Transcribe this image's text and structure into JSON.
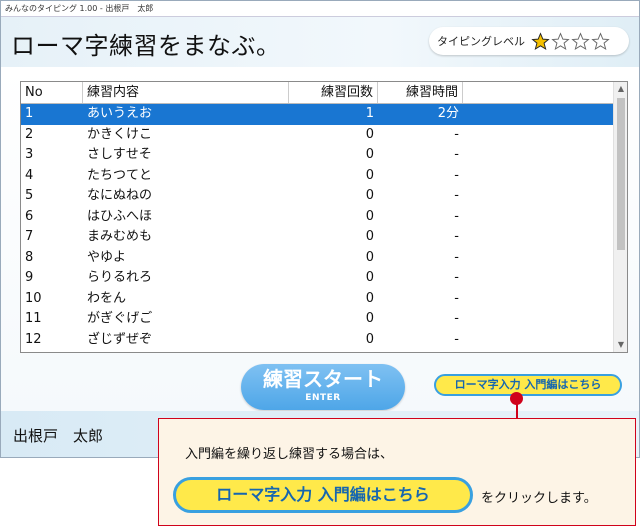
{
  "window": {
    "title": "みんなのタイピング 1.00 - 出根戸　太郎"
  },
  "header": {
    "page_title": "ローマ字練習をまなぶ。",
    "level_label": "タイピングレベル",
    "level_stars": {
      "filled": 1,
      "total": 4
    },
    "colors": {
      "star_filled": "#f5c000",
      "star_empty": "#ffffff"
    }
  },
  "grid": {
    "columns": [
      "No",
      "練習内容",
      "練習回数",
      "練習時間"
    ],
    "rows": [
      {
        "no": "1",
        "content": "あいうえお",
        "count": "1",
        "time": "2分",
        "selected": true
      },
      {
        "no": "2",
        "content": "かきくけこ",
        "count": "0",
        "time": "-"
      },
      {
        "no": "3",
        "content": "さしすせそ",
        "count": "0",
        "time": "-"
      },
      {
        "no": "4",
        "content": "たちつてと",
        "count": "0",
        "time": "-"
      },
      {
        "no": "5",
        "content": "なにぬねの",
        "count": "0",
        "time": "-"
      },
      {
        "no": "6",
        "content": "はひふへほ",
        "count": "0",
        "time": "-"
      },
      {
        "no": "7",
        "content": "まみむめも",
        "count": "0",
        "time": "-"
      },
      {
        "no": "8",
        "content": "やゆよ",
        "count": "0",
        "time": "-"
      },
      {
        "no": "9",
        "content": "らりるれろ",
        "count": "0",
        "time": "-"
      },
      {
        "no": "10",
        "content": "わをん",
        "count": "0",
        "time": "-"
      },
      {
        "no": "11",
        "content": "がぎぐげご",
        "count": "0",
        "time": "-"
      },
      {
        "no": "12",
        "content": "ざじずぜぞ",
        "count": "0",
        "time": "-"
      }
    ],
    "selection_color": "#1976d2"
  },
  "buttons": {
    "start_label": "練習スタート",
    "start_sub": "ENTER",
    "intro_link": "ローマ字入力 入門編はこちら"
  },
  "footer": {
    "user_name": "出根戸　太郎"
  },
  "callout": {
    "text1": "入門編を繰り返し練習する場合は、",
    "link_label": "ローマ字入力 入門編はこちら",
    "text2": "をクリックします。"
  },
  "colors": {
    "accent": "#39a0e0",
    "link_bg": "#ffe94a",
    "callout_border": "#d0021b"
  }
}
